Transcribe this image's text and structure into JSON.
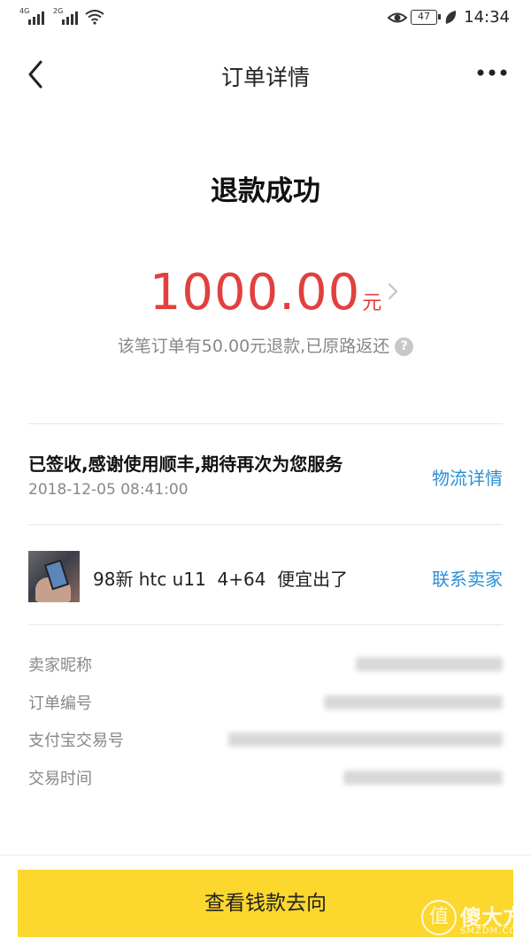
{
  "status_bar": {
    "sim1_label": "4G",
    "sim2_label": "2G",
    "battery_level": "47",
    "time": "14:34"
  },
  "nav": {
    "title": "订单详情"
  },
  "refund": {
    "status_title": "退款成功",
    "amount": "1000.00",
    "unit": "元",
    "note": "该笔订单有50.00元退款,已原路返还",
    "help_glyph": "?"
  },
  "logistics": {
    "message": "已签收,感谢使用顺丰,期待再次为您服务",
    "timestamp": "2018-12-05 08:41:00",
    "link_label": "物流详情"
  },
  "item": {
    "title": "98新 htc u11  4+64  便宜出了",
    "link_label": "联系卖家"
  },
  "order_info": {
    "labels": [
      "卖家昵称",
      "订单编号",
      "支付宝交易号",
      "交易时间"
    ]
  },
  "footer": {
    "cta_label": "查看钱款去向"
  },
  "watermark": {
    "circle_glyph": "值",
    "brand_text": "傻大方",
    "site_text": "SMZDM.COM"
  },
  "colors": {
    "accent_red": "#e0413f",
    "link_blue": "#2d8fd4",
    "cta_yellow": "#fcd72d"
  }
}
